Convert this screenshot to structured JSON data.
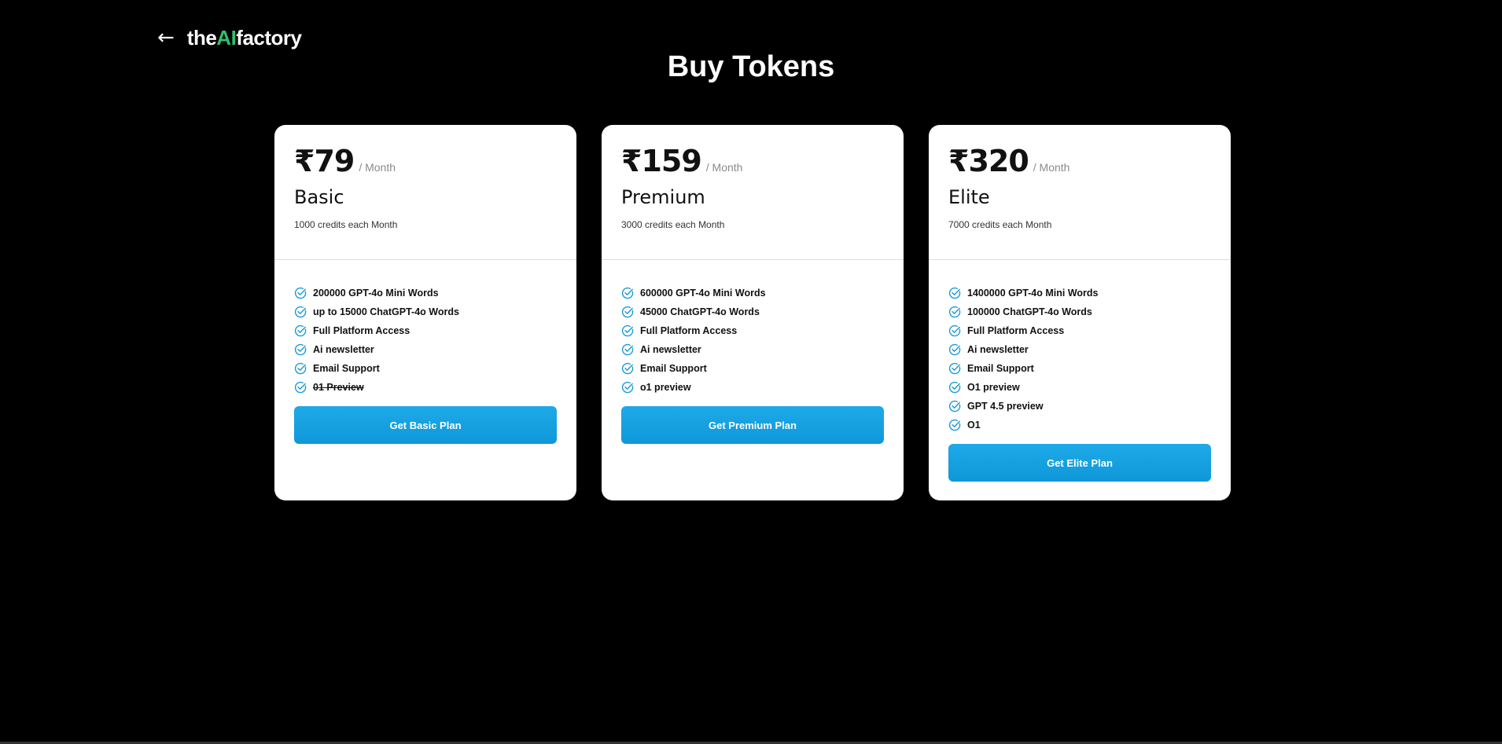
{
  "header": {
    "back_arrow": "←",
    "logo_prefix": "the",
    "logo_ai": "AI",
    "logo_suffix": "factory",
    "title": "Buy Tokens"
  },
  "colors": {
    "background": "#000000",
    "logo_accent": "#2fbf71",
    "button": "#169fdf",
    "check": "#1a9ad6"
  },
  "plans": [
    {
      "price": "₹79",
      "period": "/ Month",
      "name": "Basic",
      "credits": "1000 credits each Month",
      "features": [
        {
          "text": "200000 GPT-4o Mini Words",
          "icon": "check-circle-icon"
        },
        {
          "text": "up to 15000 ChatGPT-4o Words",
          "icon": "check-circle-icon"
        },
        {
          "text": "Full Platform Access",
          "icon": "check-circle-icon"
        },
        {
          "text": "Ai newsletter",
          "icon": "check-circle-icon"
        },
        {
          "text": "Email Support",
          "icon": "check-circle-icon"
        },
        {
          "text": "01 Preview",
          "icon": "check-circle-icon",
          "struck": true
        }
      ],
      "button": "Get Basic Plan"
    },
    {
      "price": "₹159",
      "period": "/ Month",
      "name": "Premium",
      "credits": "3000 credits each Month",
      "features": [
        {
          "text": "600000 GPT-4o Mini Words",
          "icon": "check-circle-icon"
        },
        {
          "text": "45000 ChatGPT-4o Words",
          "icon": "check-circle-icon"
        },
        {
          "text": "Full Platform Access",
          "icon": "check-circle-icon"
        },
        {
          "text": "Ai newsletter",
          "icon": "check-circle-icon"
        },
        {
          "text": "Email Support",
          "icon": "check-circle-icon"
        },
        {
          "text": "o1 preview",
          "icon": "check-circle-icon"
        }
      ],
      "button": "Get Premium Plan"
    },
    {
      "price": "₹320",
      "period": "/ Month",
      "name": "Elite",
      "credits": "7000 credits each Month",
      "features": [
        {
          "text": "1400000 GPT-4o Mini Words",
          "icon": "check-circle-icon"
        },
        {
          "text": "100000 ChatGPT-4o Words",
          "icon": "check-circle-icon"
        },
        {
          "text": "Full Platform Access",
          "icon": "check-circle-icon"
        },
        {
          "text": "Ai newsletter",
          "icon": "check-circle-icon"
        },
        {
          "text": "Email Support",
          "icon": "check-circle-icon"
        },
        {
          "text": "O1 preview",
          "icon": "check-circle-icon"
        },
        {
          "text": "GPT 4.5 preview",
          "icon": "check-circle-icon"
        },
        {
          "text": "O1",
          "icon": "check-circle-icon"
        }
      ],
      "button": "Get Elite Plan"
    }
  ]
}
